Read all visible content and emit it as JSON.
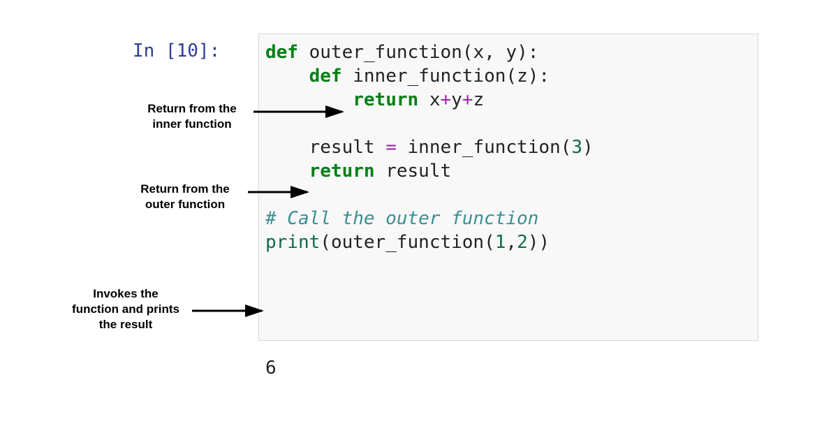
{
  "prompt": "In [10]: ",
  "code": {
    "l1": {
      "def": "def ",
      "name": "outer_function",
      "paren_open": "(",
      "args": "x, y",
      "paren_close": "):"
    },
    "l2": {
      "indent": "    ",
      "def": "def ",
      "name": "inner_function",
      "paren_open": "(",
      "args": "z",
      "paren_close": "):"
    },
    "l3": {
      "indent": "        ",
      "kw": "return ",
      "a": "x",
      "op1": "+",
      "b": "y",
      "op2": "+",
      "c": "z"
    },
    "l4": "",
    "l5": {
      "indent": "    ",
      "lhs": "result ",
      "eq": "=",
      "sp": " ",
      "call": "inner_function",
      "po": "(",
      "arg": "3",
      "pc": ")"
    },
    "l6": {
      "indent": "    ",
      "kw": "return ",
      "var": "result"
    },
    "l7": "",
    "l8": {
      "indent": "",
      "text": "# Call the outer function"
    },
    "l9": {
      "builtin": "print",
      "po": "(",
      "call": "outer_function",
      "po2": "(",
      "a1": "1",
      "comma": ",",
      "a2": "2",
      "pc2": ")",
      "pc": ")"
    }
  },
  "output": "6",
  "annotations": {
    "a1": "Return from the\ninner function",
    "a2": "Return from the\nouter function",
    "a3": "Invokes the\nfunction and prints\nthe result"
  }
}
